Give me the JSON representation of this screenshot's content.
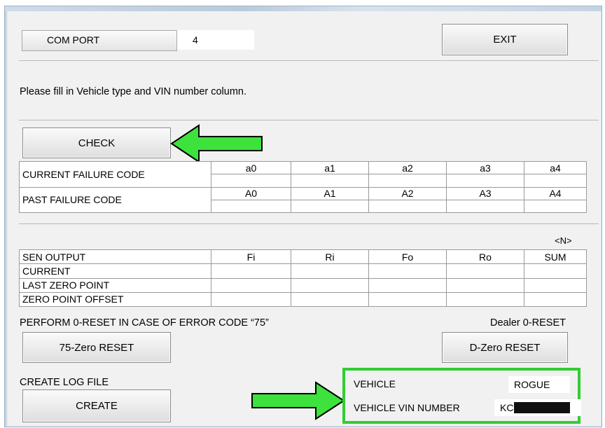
{
  "com_port": {
    "label": "COM PORT",
    "value": "4"
  },
  "exit_button": {
    "label": "EXIT"
  },
  "message": "Please fill in Vehicle type and VIN number column.",
  "check_button": {
    "label": "CHECK"
  },
  "failure_table": {
    "current_label": "CURRENT FAILURE CODE",
    "past_label": "PAST FAILURE CODE",
    "current_codes": [
      "a0",
      "a1",
      "a2",
      "a3",
      "a4"
    ],
    "past_codes": [
      "A0",
      "A1",
      "A2",
      "A3",
      "A4"
    ]
  },
  "unit_label": "<N>",
  "sensor_table": {
    "header_label": "SEN OUTPUT",
    "columns": [
      "Fi",
      "Ri",
      "Fo",
      "Ro",
      "SUM"
    ],
    "rows": [
      "CURRENT",
      "LAST ZERO POINT",
      "ZERO POINT OFFSET"
    ]
  },
  "reset_section": {
    "perform_label": "PERFORM 0-RESET IN CASE OF ERROR CODE “75”",
    "dealer_label": "Dealer 0-RESET",
    "zero75_button": "75-Zero RESET",
    "dzero_button": "D-Zero RESET"
  },
  "log_section": {
    "label": "CREATE LOG FILE",
    "create_button": "CREATE"
  },
  "vehicle_panel": {
    "vehicle_label": "VEHICLE",
    "vehicle_value": "ROGUE",
    "vin_label": "VEHICLE VIN NUMBER",
    "vin_value": "KC"
  },
  "colors": {
    "highlight_green": "#33cc33",
    "arrow_green": "#3de23d",
    "window_bg": "#f1f1f1"
  }
}
